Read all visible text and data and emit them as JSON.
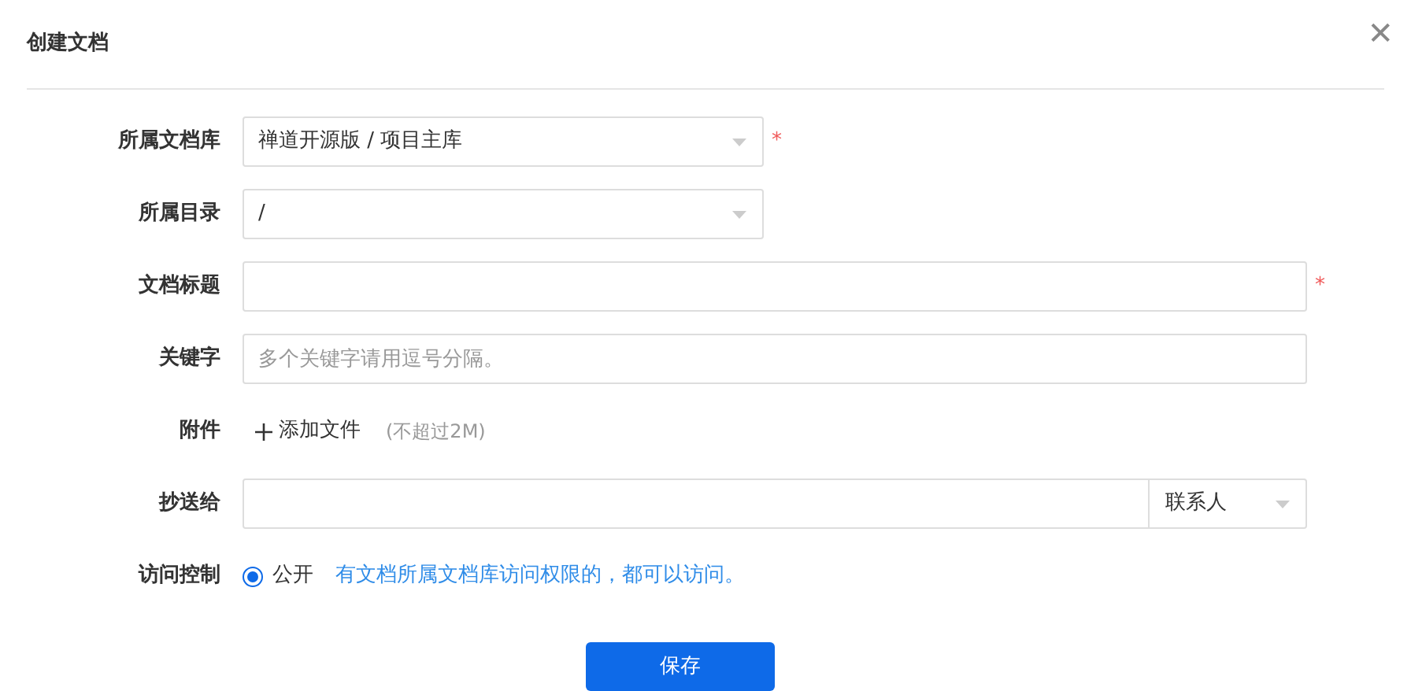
{
  "dialog": {
    "title": "创建文档",
    "close": "✕"
  },
  "fields": [
    {
      "kind": "select",
      "label": "所属文档库",
      "value": "禅道开源版 / 项目主库",
      "required_mark": "*"
    },
    {
      "kind": "select",
      "label": "所属目录",
      "value": "/"
    },
    {
      "kind": "input",
      "label": "文档标题",
      "required_mark": "*"
    },
    {
      "kind": "input",
      "label": "关键字",
      "placeholder": "多个关键字请用逗号分隔。"
    },
    {
      "kind": "file",
      "label": "附件",
      "action": "添加文件",
      "hint": "(不超过2M)"
    },
    {
      "kind": "cc",
      "label": "抄送给",
      "option": "联系人"
    },
    {
      "kind": "radio",
      "label": "访问控制",
      "options": [
        {
          "label": "公开",
          "selected": true
        }
      ],
      "note": "有文档所属文档库访问权限的，都可以访问。"
    }
  ],
  "save_button": "保存"
}
